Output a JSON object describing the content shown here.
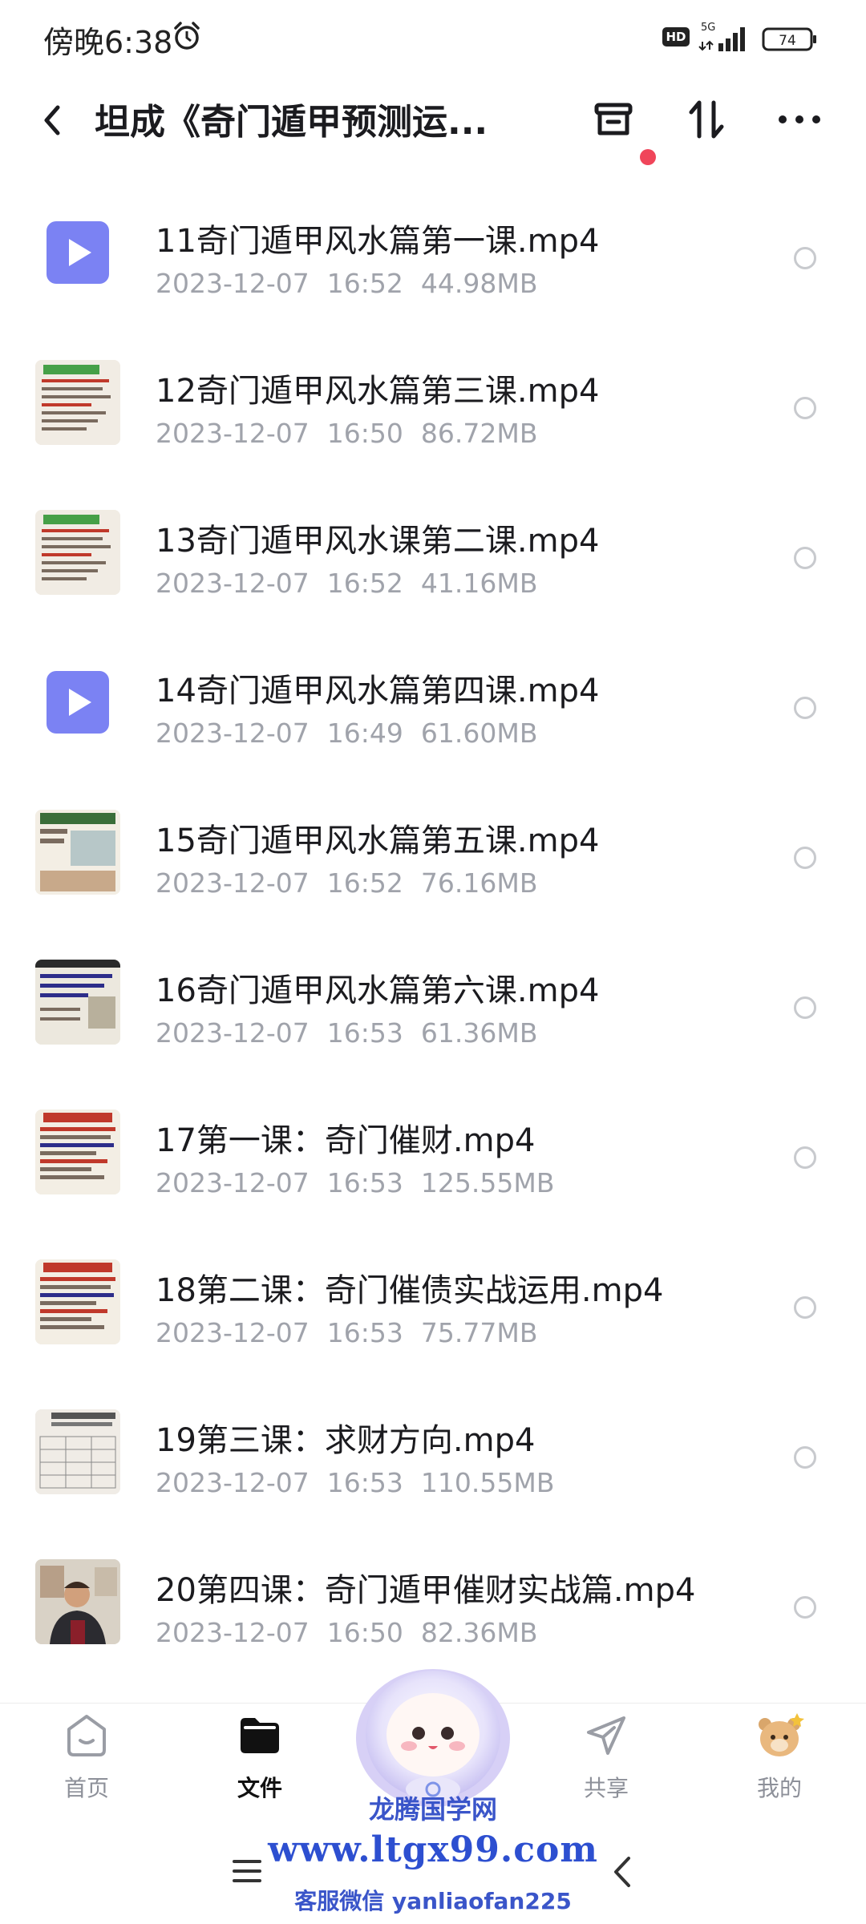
{
  "status_bar": {
    "time": "傍晚6:38",
    "hd": "HD",
    "network": "5G",
    "battery": "74"
  },
  "header": {
    "title": "坦成《奇门遁甲预测运..."
  },
  "files": [
    {
      "name": "11奇门遁甲风水篇第一课.mp4",
      "date": "2023-12-07",
      "time": "16:52",
      "size": "44.98MB",
      "thumb": "video"
    },
    {
      "name": "12奇门遁甲风水篇第三课.mp4",
      "date": "2023-12-07",
      "time": "16:50",
      "size": "86.72MB",
      "thumb": "slide-green"
    },
    {
      "name": "13奇门遁甲风水课第二课.mp4",
      "date": "2023-12-07",
      "time": "16:52",
      "size": "41.16MB",
      "thumb": "slide-green"
    },
    {
      "name": "14奇门遁甲风水篇第四课.mp4",
      "date": "2023-12-07",
      "time": "16:49",
      "size": "61.60MB",
      "thumb": "video"
    },
    {
      "name": "15奇门遁甲风水篇第五课.mp4",
      "date": "2023-12-07",
      "time": "16:52",
      "size": "76.16MB",
      "thumb": "slide-photo"
    },
    {
      "name": "16奇门遁甲风水篇第六课.mp4",
      "date": "2023-12-07",
      "time": "16:53",
      "size": "61.36MB",
      "thumb": "slide-dark"
    },
    {
      "name": "17第一课：奇门催财.mp4",
      "date": "2023-12-07",
      "time": "16:53",
      "size": "125.55MB",
      "thumb": "slide-red"
    },
    {
      "name": "18第二课：奇门催债实战运用.mp4",
      "date": "2023-12-07",
      "time": "16:53",
      "size": "75.77MB",
      "thumb": "slide-red"
    },
    {
      "name": "19第三课：求财方向.mp4",
      "date": "2023-12-07",
      "time": "16:53",
      "size": "110.55MB",
      "thumb": "slide-table"
    },
    {
      "name": "20第四课：奇门遁甲催财实战篇.mp4",
      "date": "2023-12-07",
      "time": "16:50",
      "size": "82.36MB",
      "thumb": "person"
    }
  ],
  "bottom_nav": [
    {
      "label": "首页",
      "icon": "home-icon",
      "active": false
    },
    {
      "label": "文件",
      "icon": "folder-icon",
      "active": true
    },
    {
      "label": "共享",
      "icon": "share-icon",
      "active": false
    },
    {
      "label": "我的",
      "icon": "avatar-icon",
      "active": false
    }
  ],
  "watermark": {
    "name": "龙腾国学网",
    "url": "www.ltgx99.com",
    "contact": "客服微信 yanliaofan225"
  },
  "colors": {
    "accent": "#7b82f3",
    "badge": "#f0455a",
    "meta": "#a0a3ab"
  }
}
